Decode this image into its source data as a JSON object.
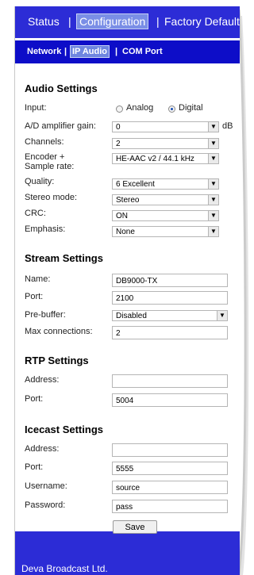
{
  "topnav": {
    "items": [
      "Status",
      "Configuration",
      "Factory Default"
    ],
    "separator": "|",
    "active": "Configuration"
  },
  "subnav": {
    "items": [
      "Network",
      "IP Audio",
      "COM Port"
    ],
    "separator": "|",
    "active": "IP Audio"
  },
  "audio_settings": {
    "title": "Audio Settings",
    "input": {
      "label": "Input:",
      "options": [
        "Analog",
        "Digital"
      ],
      "selected": "Digital"
    },
    "ad_gain": {
      "label": "A/D amplifier gain:",
      "value": "0",
      "unit": "dB"
    },
    "channels": {
      "label": "Channels:",
      "value": "2"
    },
    "encoder": {
      "label_line1": "Encoder +",
      "label_line2": "Sample rate:",
      "value": "HE-AAC v2 / 44.1 kHz"
    },
    "quality": {
      "label": "Quality:",
      "value": "6 Excellent"
    },
    "stereo_mode": {
      "label": "Stereo mode:",
      "value": "Stereo"
    },
    "crc": {
      "label": "CRC:",
      "value": "ON"
    },
    "emphasis": {
      "label": "Emphasis:",
      "value": "None"
    }
  },
  "stream_settings": {
    "title": "Stream Settings",
    "name": {
      "label": "Name:",
      "value": "DB9000-TX"
    },
    "port": {
      "label": "Port:",
      "value": "2100"
    },
    "pre_buffer": {
      "label": "Pre-buffer:",
      "value": "Disabled"
    },
    "max_connections": {
      "label": "Max connections:",
      "value": "2"
    }
  },
  "rtp_settings": {
    "title": "RTP Settings",
    "address": {
      "label": "Address:",
      "value": ""
    },
    "port": {
      "label": "Port:",
      "value": "5004"
    }
  },
  "icecast_settings": {
    "title": "Icecast Settings",
    "address": {
      "label": "Address:",
      "value": ""
    },
    "port": {
      "label": "Port:",
      "value": "5555"
    },
    "username": {
      "label": "Username:",
      "value": "source"
    },
    "password": {
      "label": "Password:",
      "value": "pass"
    }
  },
  "save_label": "Save",
  "footer_text": "Deva Broadcast Ltd.",
  "colors": {
    "header_blue": "#2c2cd6",
    "subnav_blue": "#0d0dc8",
    "active_tab": "#7a8ee6"
  }
}
